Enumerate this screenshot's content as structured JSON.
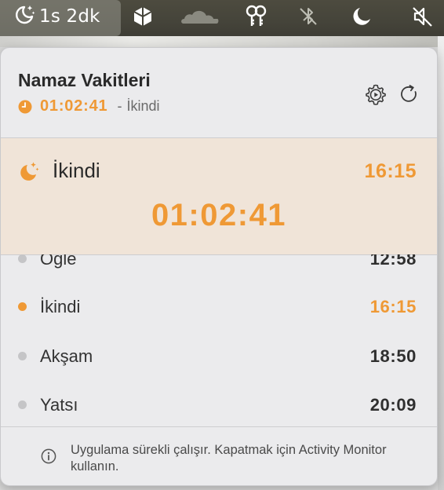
{
  "menubar": {
    "timer_label": "1s 2dk",
    "icons": [
      "moon-stars-icon",
      "dropbox-icon",
      "cloudflare-icon",
      "keys-icon",
      "bluetooth-off-icon",
      "moon-icon",
      "mute-icon"
    ]
  },
  "header": {
    "title": "Namaz Vakitleri",
    "countdown": "01:02:41",
    "separator": "-",
    "next_prayer": "İkindi",
    "icons": [
      "clock-icon",
      "settings-icon",
      "refresh-icon"
    ]
  },
  "highlight": {
    "prayer_name": "İkindi",
    "prayer_time": "16:15",
    "countdown": "01:02:41"
  },
  "prayers": [
    {
      "name": "Öğle",
      "time": "12:58",
      "active": false
    },
    {
      "name": "İkindi",
      "time": "16:15",
      "active": true
    },
    {
      "name": "Akşam",
      "time": "18:50",
      "active": false
    },
    {
      "name": "Yatsı",
      "time": "20:09",
      "active": false
    }
  ],
  "footer": {
    "info_text": "Uygulama sürekli çalışır. Kapatmak için Activity Monitor kullanın."
  },
  "colors": {
    "accent": "#ef9935",
    "highlight_bg": "#f0e4d8",
    "popover_bg": "#ebebed"
  }
}
